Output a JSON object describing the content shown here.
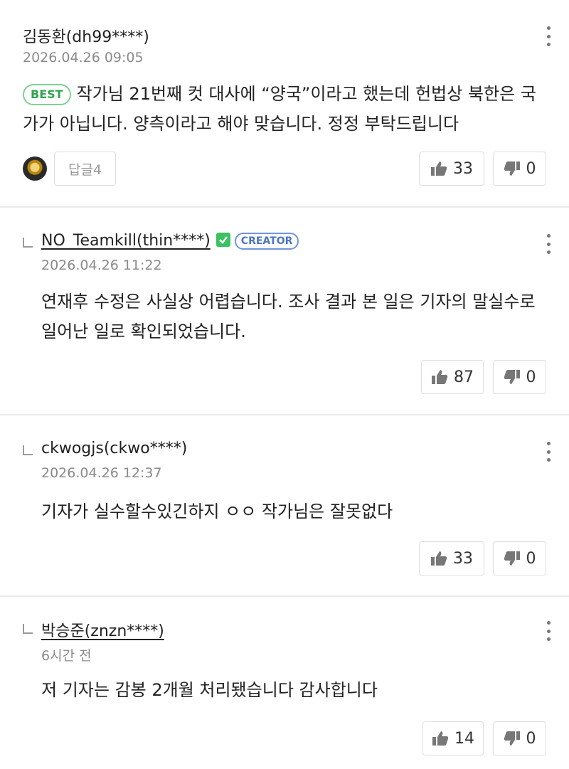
{
  "comments": [
    {
      "author": "김동환(dh99****)",
      "date": "2026.04.26 09:05",
      "badge": "BEST",
      "text": "작가님 21번째 컷 대사에 “양국”이라고 했는데 헌법상 북한은 국가가 아닙니다. 양측이라고 해야 맞습니다. 정정 부탁드립니다",
      "reply_label": "답글4",
      "likes": "33",
      "dislikes": "0"
    },
    {
      "author": "NO_Teamkill(thin****)",
      "creator_badge": "CREATOR",
      "date": "2026.04.26 11:22",
      "text": "연재후 수정은 사실상 어렵습니다. 조사 결과 본 일은 기자의 말실수로 일어난 일로 확인되었습니다.",
      "likes": "87",
      "dislikes": "0"
    },
    {
      "author": "ckwogjs(ckwo****)",
      "date": "2026.04.26 12:37",
      "text": "기자가 실수할수있긴하지 ㅇㅇ 작가님은 잘못없다",
      "likes": "33",
      "dislikes": "0"
    },
    {
      "author": "박승준(znzn****)",
      "date": "6시간 전",
      "text": "저 기자는 감봉 2개월 처리됐습니다 감사합니다",
      "likes": "14",
      "dislikes": "0"
    }
  ],
  "icons": {
    "like": "thumbs-up-icon",
    "dislike": "thumbs-down-icon",
    "more": "more-vertical-icon",
    "verified": "check-icon"
  },
  "colors": {
    "best": "#2ea44f",
    "creator": "#4a74c9",
    "verified": "#3cc163",
    "divider": "#ebebeb"
  }
}
